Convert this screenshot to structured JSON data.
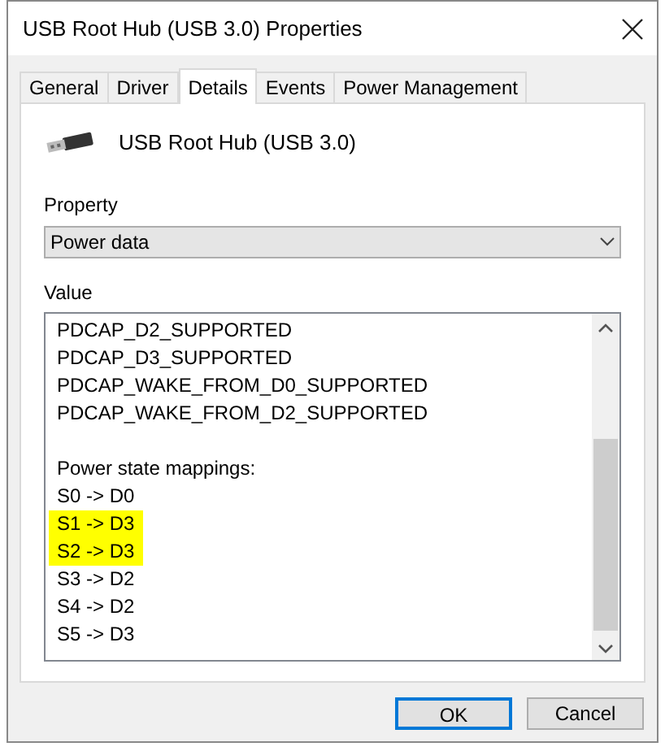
{
  "window": {
    "title": "USB Root Hub (USB 3.0) Properties"
  },
  "tabs": [
    {
      "label": "General",
      "selected": false
    },
    {
      "label": "Driver",
      "selected": false
    },
    {
      "label": "Details",
      "selected": true
    },
    {
      "label": "Events",
      "selected": false
    },
    {
      "label": "Power Management",
      "selected": false
    }
  ],
  "device": {
    "name": "USB Root Hub (USB 3.0)"
  },
  "property": {
    "label": "Property",
    "value": "Power data"
  },
  "value": {
    "label": "Value",
    "lines": [
      {
        "text": "PDCAP_D2_SUPPORTED",
        "highlighted": false,
        "kind": "entry"
      },
      {
        "text": "PDCAP_D3_SUPPORTED",
        "highlighted": false,
        "kind": "entry"
      },
      {
        "text": "PDCAP_WAKE_FROM_D0_SUPPORTED",
        "highlighted": false,
        "kind": "entry"
      },
      {
        "text": "PDCAP_WAKE_FROM_D2_SUPPORTED",
        "highlighted": false,
        "kind": "entry"
      },
      {
        "text": "Power state mappings:",
        "highlighted": false,
        "kind": "section"
      },
      {
        "text": "S0 -> D0",
        "highlighted": false,
        "kind": "entry"
      },
      {
        "text": "S1 -> D3",
        "highlighted": true,
        "kind": "entry"
      },
      {
        "text": "S2 -> D3",
        "highlighted": true,
        "kind": "entry"
      },
      {
        "text": "S3 -> D2",
        "highlighted": false,
        "kind": "entry"
      },
      {
        "text": "S4 -> D2",
        "highlighted": false,
        "kind": "entry"
      },
      {
        "text": "S5 -> D3",
        "highlighted": false,
        "kind": "entry"
      }
    ]
  },
  "buttons": [
    {
      "label": "OK",
      "default": true
    },
    {
      "label": "Cancel",
      "default": false
    }
  ]
}
